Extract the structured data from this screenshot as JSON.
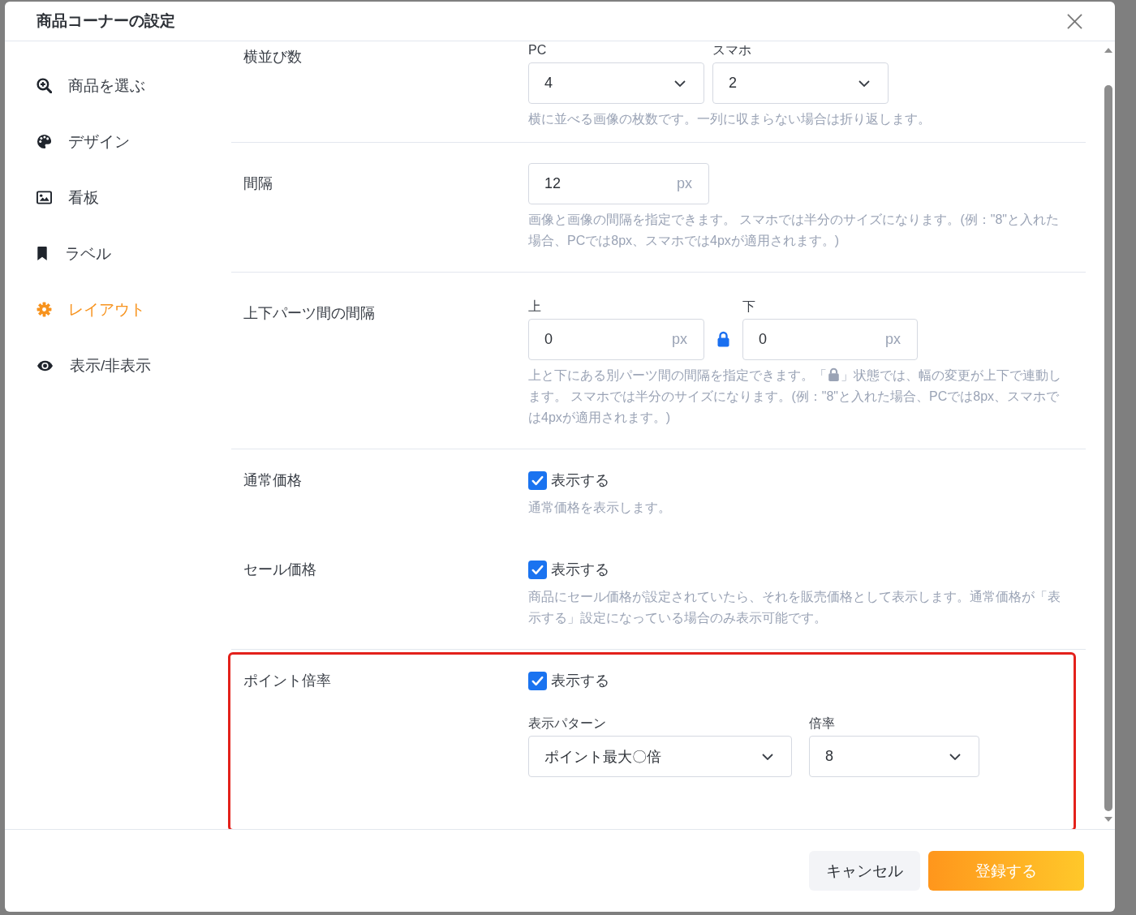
{
  "dialog": {
    "title": "商品コーナーの設定"
  },
  "sidebar": {
    "items": [
      {
        "label": "商品を選ぶ",
        "selected": false
      },
      {
        "label": "デザイン",
        "selected": false
      },
      {
        "label": "看板",
        "selected": false
      },
      {
        "label": "ラベル",
        "selected": false
      },
      {
        "label": "レイアウト",
        "selected": true
      },
      {
        "label": "表示/非表示",
        "selected": false
      }
    ]
  },
  "sections": [
    {
      "highlighted": false,
      "rows": [
        {
          "label": "横並び数",
          "fields": [
            {
              "kind": "select",
              "label": "PC",
              "value": "4"
            },
            {
              "kind": "select",
              "label": "スマホ",
              "value": "2"
            }
          ],
          "help": "横に並べる画像の枚数です。一列に収まらない場合は折り返します。"
        }
      ]
    },
    {
      "highlighted": false,
      "rows": [
        {
          "label": "間隔",
          "fields": [
            {
              "kind": "input",
              "value": "12",
              "unit": "px"
            }
          ],
          "help": "画像と画像の間隔を指定できます。 スマホでは半分のサイズになります。(例：\"8\"と入れた場合、PCでは8px、スマホでは4pxが適用されます。)"
        }
      ]
    },
    {
      "highlighted": false,
      "rows": [
        {
          "label": "上下パーツ間の間隔",
          "locked": true,
          "fields": [
            {
              "kind": "input",
              "label": "上",
              "value": "0",
              "unit": "px"
            },
            {
              "kind": "input",
              "label": "下",
              "value": "0",
              "unit": "px"
            }
          ],
          "help_parts": [
            "上と下にある別パーツ間の間隔を指定できます。「",
            "」状態では、幅の変更が上下で連動します。 スマホでは半分のサイズになります。(例：\"8\"と入れた場合、PCでは8px、スマホでは4pxが適用されます。)"
          ]
        }
      ]
    },
    {
      "highlighted": false,
      "rows": [
        {
          "label": "通常価格",
          "checkbox": {
            "label": "表示する",
            "checked": true
          },
          "help": "通常価格を表示します。"
        },
        {
          "label": "セール価格",
          "checkbox": {
            "label": "表示する",
            "checked": true
          },
          "help": "商品にセール価格が設定されていたら、それを販売価格として表示します。通常価格が「表示する」設定になっている場合のみ表示可能です。"
        }
      ]
    },
    {
      "highlighted": true,
      "rows": [
        {
          "label": "ポイント倍率",
          "checkbox": {
            "label": "表示する",
            "checked": true
          },
          "fields": [
            {
              "kind": "select",
              "label": "表示パターン",
              "value": "ポイント最大〇倍"
            },
            {
              "kind": "select",
              "label": "倍率",
              "value": "8"
            }
          ]
        }
      ]
    }
  ],
  "footer": {
    "buttons": [
      {
        "label": "キャンセル",
        "kind": "secondary"
      },
      {
        "label": "登録する",
        "kind": "primary"
      }
    ]
  }
}
